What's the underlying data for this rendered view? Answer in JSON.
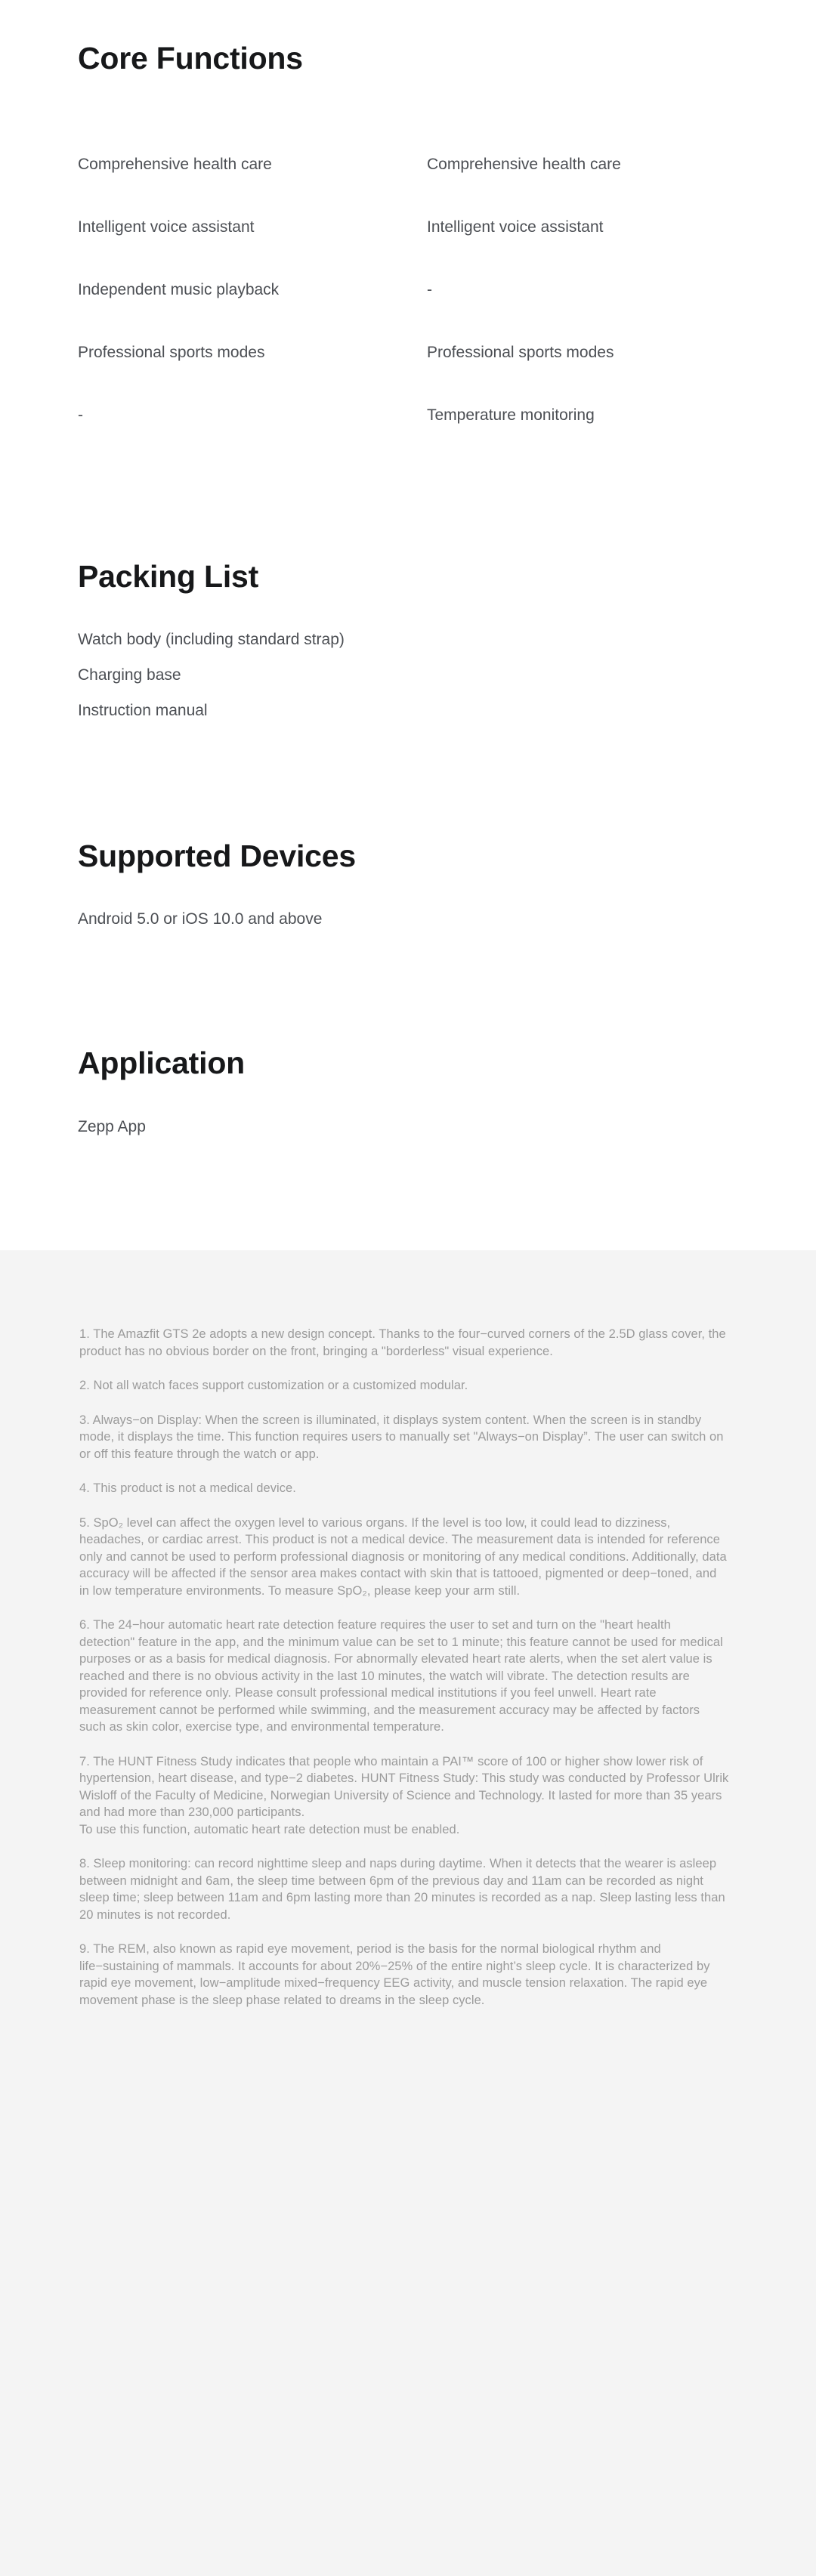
{
  "colors": {
    "page_background": "#ffffff",
    "notes_background": "#f4f4f4",
    "heading_text": "#17181a",
    "body_text": "#4c4f54",
    "note_text": "#9b9b9b"
  },
  "sections": {
    "core_functions": {
      "heading": "Core Functions",
      "rows": [
        {
          "left": "Comprehensive health care",
          "right": "Comprehensive health care"
        },
        {
          "left": "Intelligent voice assistant",
          "right": "Intelligent voice assistant"
        },
        {
          "left": "Independent music playback",
          "right": "-"
        },
        {
          "left": "Professional sports modes",
          "right": "Professional sports modes"
        },
        {
          "left": "-",
          "right": "Temperature monitoring"
        }
      ]
    },
    "packing_list": {
      "heading": "Packing List",
      "items": [
        "Watch body (including standard strap)",
        "Charging base",
        "Instruction manual"
      ]
    },
    "supported_devices": {
      "heading": "Supported Devices",
      "items": [
        "Android 5.0 or iOS 10.0 and above"
      ]
    },
    "application": {
      "heading": "Application",
      "items": [
        "Zepp App"
      ]
    }
  },
  "notes": [
    "1. The Amazfit GTS 2e adopts a new design concept. Thanks to the four−curved corners of the 2.5D glass cover, the product has no obvious border on the front, bringing a \"borderless\" visual experience.",
    "2. Not all watch faces support customization or a customized modular.",
    "3. Always−on Display: When the screen is illuminated, it displays system content. When the screen is in standby mode, it displays the time. This function requires users to manually set \"Always−on Display”. The user can switch on or off this feature through the watch or app.",
    "4. This product is not a medical device.",
    "5. SpO₂ level can affect the oxygen level to various organs. If the level is too low, it could lead to dizziness, headaches, or cardiac arrest. This product is not a medical device. The measurement data is intended for reference only and cannot be used to perform professional diagnosis or monitoring of any medical conditions. Additionally, data accuracy will be affected if the sensor area makes contact with skin that is tattooed, pigmented or deep−toned, and in low temperature environments. To measure SpO₂, please keep your arm still.",
    "6. The 24−hour automatic heart rate detection feature requires the user to set and turn on the \"heart health detection\" feature in the app, and the minimum value can be set to 1 minute; this feature cannot be used for medical purposes or as a basis for medical diagnosis. For abnormally elevated heart rate alerts, when the set alert value is reached and there is no obvious activity in the last 10 minutes, the watch will vibrate. The detection results are provided for reference only. Please consult professional medical institutions if you feel unwell. Heart rate measurement cannot be performed while swimming, and the measurement accuracy may be affected by factors such as skin color, exercise type, and environmental temperature.",
    "7. The HUNT Fitness Study indicates that people who maintain a PAI™ score of 100 or higher show lower risk of hypertension, heart disease, and type−2 diabetes. HUNT Fitness Study: This study was conducted by Professor Ulrik Wisloff of the Faculty of Medicine, Norwegian University of Science and Technology. It lasted for more than 35 years and had more than 230,000 participants.\nTo use this function, automatic heart rate detection must be enabled.",
    "8. Sleep monitoring: can record nighttime sleep and naps during daytime. When it detects that the wearer is asleep between midnight and 6am, the sleep time between 6pm of the previous day and 11am can be recorded as night sleep time; sleep between 11am and 6pm lasting more than 20 minutes is recorded as a nap. Sleep lasting less than 20 minutes is not recorded.",
    "9. The REM, also known as rapid eye movement, period is the basis for the normal biological rhythm and life−sustaining of mammals. It accounts for about 20%−25% of the entire night’s sleep cycle. It is characterized by rapid eye movement, low−amplitude mixed−frequency EEG activity, and muscle tension relaxation. The rapid eye movement phase is the sleep phase related to dreams in the sleep cycle."
  ]
}
